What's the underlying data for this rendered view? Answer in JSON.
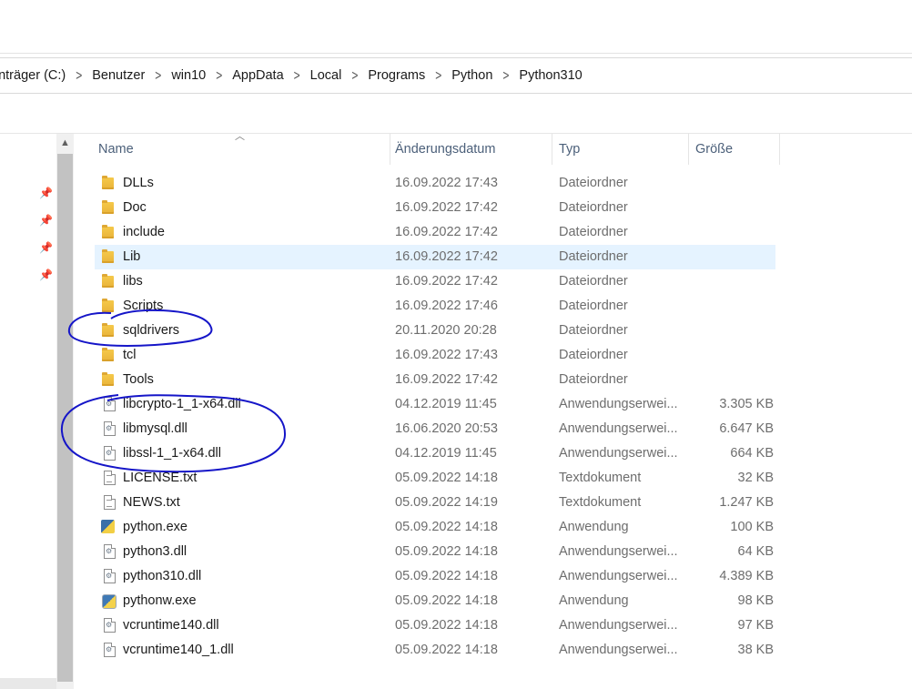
{
  "breadcrumb": [
    "tenträger (C:)",
    "Benutzer",
    "win10",
    "AppData",
    "Local",
    "Programs",
    "Python",
    "Python310"
  ],
  "columns": {
    "name": "Name",
    "date": "Änderungsdatum",
    "type": "Typ",
    "size": "Größe"
  },
  "files": [
    {
      "name": "DLLs",
      "date": "16.09.2022 17:43",
      "type": "Dateiordner",
      "size": "",
      "icon": "folder-icon"
    },
    {
      "name": "Doc",
      "date": "16.09.2022 17:42",
      "type": "Dateiordner",
      "size": "",
      "icon": "folder-icon"
    },
    {
      "name": "include",
      "date": "16.09.2022 17:42",
      "type": "Dateiordner",
      "size": "",
      "icon": "folder-icon"
    },
    {
      "name": "Lib",
      "date": "16.09.2022 17:42",
      "type": "Dateiordner",
      "size": "",
      "icon": "folder-icon",
      "selected": true
    },
    {
      "name": "libs",
      "date": "16.09.2022 17:42",
      "type": "Dateiordner",
      "size": "",
      "icon": "folder-icon"
    },
    {
      "name": "Scripts",
      "date": "16.09.2022 17:46",
      "type": "Dateiordner",
      "size": "",
      "icon": "folder-icon"
    },
    {
      "name": "sqldrivers",
      "date": "20.11.2020 20:28",
      "type": "Dateiordner",
      "size": "",
      "icon": "folder-icon"
    },
    {
      "name": "tcl",
      "date": "16.09.2022 17:43",
      "type": "Dateiordner",
      "size": "",
      "icon": "folder-icon"
    },
    {
      "name": "Tools",
      "date": "16.09.2022 17:42",
      "type": "Dateiordner",
      "size": "",
      "icon": "folder-icon"
    },
    {
      "name": "libcrypto-1_1-x64.dll",
      "date": "04.12.2019 11:45",
      "type": "Anwendungserwei...",
      "size": "3.305 KB",
      "icon": "dll-file-icon"
    },
    {
      "name": "libmysql.dll",
      "date": "16.06.2020 20:53",
      "type": "Anwendungserwei...",
      "size": "6.647 KB",
      "icon": "dll-file-icon"
    },
    {
      "name": "libssl-1_1-x64.dll",
      "date": "04.12.2019 11:45",
      "type": "Anwendungserwei...",
      "size": "664 KB",
      "icon": "dll-file-icon"
    },
    {
      "name": "LICENSE.txt",
      "date": "05.09.2022 14:18",
      "type": "Textdokument",
      "size": "32 KB",
      "icon": "text-file-icon"
    },
    {
      "name": "NEWS.txt",
      "date": "05.09.2022 14:19",
      "type": "Textdokument",
      "size": "1.247 KB",
      "icon": "text-file-icon"
    },
    {
      "name": "python.exe",
      "date": "05.09.2022 14:18",
      "type": "Anwendung",
      "size": "100 KB",
      "icon": "python-exe-icon"
    },
    {
      "name": "python3.dll",
      "date": "05.09.2022 14:18",
      "type": "Anwendungserwei...",
      "size": "64 KB",
      "icon": "dll-file-icon"
    },
    {
      "name": "python310.dll",
      "date": "05.09.2022 14:18",
      "type": "Anwendungserwei...",
      "size": "4.389 KB",
      "icon": "dll-file-icon"
    },
    {
      "name": "pythonw.exe",
      "date": "05.09.2022 14:18",
      "type": "Anwendung",
      "size": "98 KB",
      "icon": "pythonw-exe-icon"
    },
    {
      "name": "vcruntime140.dll",
      "date": "05.09.2022 14:18",
      "type": "Anwendungserwei...",
      "size": "97 KB",
      "icon": "dll-file-icon"
    },
    {
      "name": "vcruntime140_1.dll",
      "date": "05.09.2022 14:18",
      "type": "Anwendungserwei...",
      "size": "38 KB",
      "icon": "dll-file-icon"
    }
  ],
  "colors": {
    "selection": "#e5f3ff",
    "annotation": "#1515c8",
    "folder": "#f0bf45"
  }
}
